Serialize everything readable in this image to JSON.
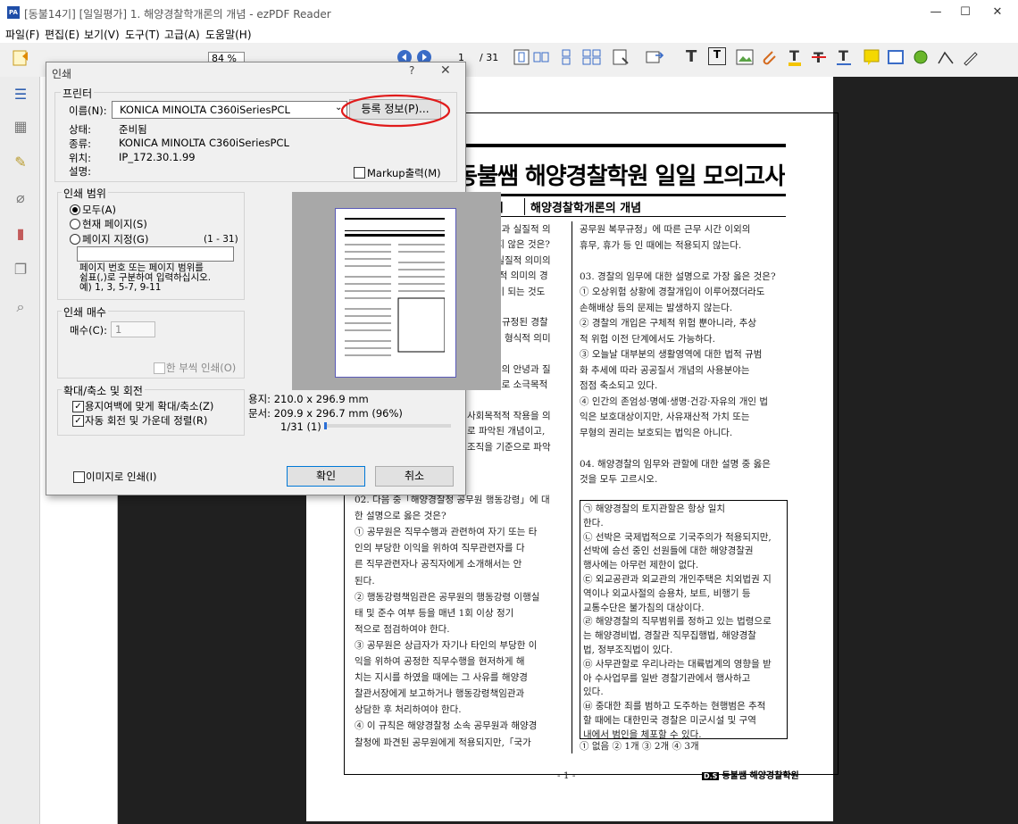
{
  "window": {
    "title": "[동불14기] [일일평가] 1. 해양경찰학개론의 개념 - ezPDF Reader",
    "app_badge": "PA",
    "min": "—",
    "max": "☐",
    "close": "✕"
  },
  "menu": [
    "파일(F)",
    "편집(E)",
    "보기(V)",
    "도구(T)",
    "고급(A)",
    "도움말(H)"
  ],
  "toolbar": {
    "zoom": "84 %",
    "page": "1",
    "total": "/ 31"
  },
  "dialog": {
    "title": "인쇄",
    "help": "?",
    "close": "✕",
    "printer_group": "프린터",
    "name_label": "이름(N):",
    "name_value": "KONICA MINOLTA C360iSeriesPCL",
    "properties_btn": "등록 정보(P)...",
    "status_label": "상태:",
    "status_value": "준비됨",
    "type_label": "종류:",
    "type_value": "KONICA MINOLTA C360iSeriesPCL",
    "where_label": "위치:",
    "where_value": "IP_172.30.1.99",
    "comment_label": "설명:",
    "markup_label": "Markup출력(M)",
    "range_group": "인쇄 범위",
    "all_label": "모두(A)",
    "current_label": "현재 페이지(S)",
    "pages_label": "페이지 지정(G)",
    "pages_range": "(1 - 31)",
    "pages_hint_1": "페이지 번호 또는 페이지 범위를",
    "pages_hint_2": "쉼표(,)로 구분하여 입력하십시오.",
    "pages_hint_3": "예) 1, 3, 5-7, 9-11",
    "copies_group": "인쇄 매수",
    "copies_label": "매수(C):",
    "copies_value": "1",
    "collate_label": "한 부씩 인쇄(O)",
    "scale_group": "확대/축소 및 회전",
    "fit_label": "용지여백에 맞게 확대/축소(Z)",
    "rotate_label": "자동 회전 및 가운데 정렬(R)",
    "paper_info": "용지: 210.0 x 296.9 mm",
    "doc_info": "문서: 209.9 x 296.7 mm (96%)",
    "page_counter": "1/31 (1)",
    "image_print_label": "이미지로 인쇄(I)",
    "ok_btn": "확인",
    "cancel_btn": "취소"
  },
  "document": {
    "header_title": "동불쌤 해양경찰학원 일일 모의고사",
    "range_label": "범위",
    "range_value": "해양경찰학개론의 개념",
    "footer_page": "- 1 -",
    "footer_brand": "동불쌤 해양경찰학원",
    "left_lines": [
      "경찰개념과 실질적 의",
      "으로 옳지 않은 것은?",
      "언제나 실질적 의미의",
      "며, 실질적 의미의 경",
      "의 경찰이 되는 것도",
      "",
      "제2조에 규정된 경찰",
      "라에서의 형식적 의미",
      "다.",
      "사회공공의 안녕과 질",
      "작용이므로 소극목적",
      "",
      "사회목적적 작용을 의",
      "로 파악된 개념이고,",
      "조직을 기준으로 파악",
      ""
    ],
    "left_lower": [
      "02. 다음 중「해양경찰청 공무원 행동강령」에 대",
      "한 설명으로 옳은 것은?",
      "① 공무원은 직무수행과 관련하여 자기 또는 타",
      "   인의 부당한 이익을 위하여 직무관련자를 다",
      "   른 직무관련자나 공직자에게 소개해서는 안",
      "   된다.",
      "② 행동강령책임관은 공무원의 행동강령 이행실",
      "   태 및 준수 여부 등을 매년 1회 이상 정기",
      "   적으로 점검하여야 한다.",
      "③ 공무원은 상급자가 자기나 타인의 부당한 이",
      "   익을 위하여 공정한 직무수행을 현저하게 해",
      "   치는 지시를 하였을 때에는 그 사유를 해양경",
      "   찰관서장에게  보고하거나  행동강령책임관과",
      "   상담한 후 처리하여야 한다.",
      "④ 이 규칙은 해양경찰청 소속 공무원과 해양경",
      "   찰청에 파견된 공무원에게 적용되지만,「국가"
    ],
    "right_lines": [
      "공무원 복무규정」에 따른 근무 시간 이외의",
      "휴무, 휴가 등 인 때에는 적용되지 않는다.",
      "",
      "03. 경찰의 임무에 대한 설명으로 가장 옳은 것은?",
      "① 오상위험 상황에 경찰개입이 이루어졌더라도",
      "   손해배상 등의 문제는 발생하지 않는다.",
      "② 경찰의 개입은 구체적 위험 뿐아니라, 추상",
      "   적 위험 이전 단계에서도 가능하다.",
      "③ 오늘날 대부분의 생활영역에 대한 법적 규범",
      "   화 추세에 따라 공공질서 개념의 사용분야는",
      "   점점 축소되고 있다.",
      "④ 인간의 존엄성·명예·생명·건강·자유의 개인 법",
      "   익은 보호대상이지만, 사유재산적 가치 또는",
      "   무형의 권리는 보호되는 법익은 아니다.",
      "",
      "04. 해양경찰의 임무와 관할에 대한 설명 중 옳은",
      "것을 모두 고르시오."
    ],
    "box_lines": [
      "㉠ 해양경찰의 토지관할은 항상 일치",
      "   한다.",
      "㉡ 선박은 국제법적으로 기국주의가 적용되지만,",
      "   선박에 승선 중인 선원들에 대한 해양경찰권",
      "   행사에는 아무런 제한이 없다.",
      "㉢ 외교공관과 외교관의 개인주택은 치외법권 지",
      "   역이나 외교사절의 승용차, 보트, 비행기 등",
      "   교통수단은 불가침의 대상이다.",
      "㉣ 해양경찰의 직무범위를 정하고 있는 법령으로",
      "   는 해양경비법, 경찰관 직무집행법, 해양경찰",
      "   법, 정부조직법이 있다.",
      "㉤ 사무관할로 우리나라는 대륙법계의 영향을 받",
      "   아 수사업무를 일반 경찰기관에서 행사하고",
      "   있다.",
      "㉥ 중대한 죄를 범하고 도주하는 현행범은 추적",
      "   할 때에는 대한민국 경찰은 미군시설 및 구역",
      "   내에서 범인을 체포할 수 있다."
    ],
    "answer_line": "① 없음     ② 1개     ③ 2개     ④ 3개"
  },
  "colors": {
    "annotation_circle": "#e01b1b",
    "dialog_bg": "#f0f0f0",
    "viewer_bg": "#202020"
  }
}
